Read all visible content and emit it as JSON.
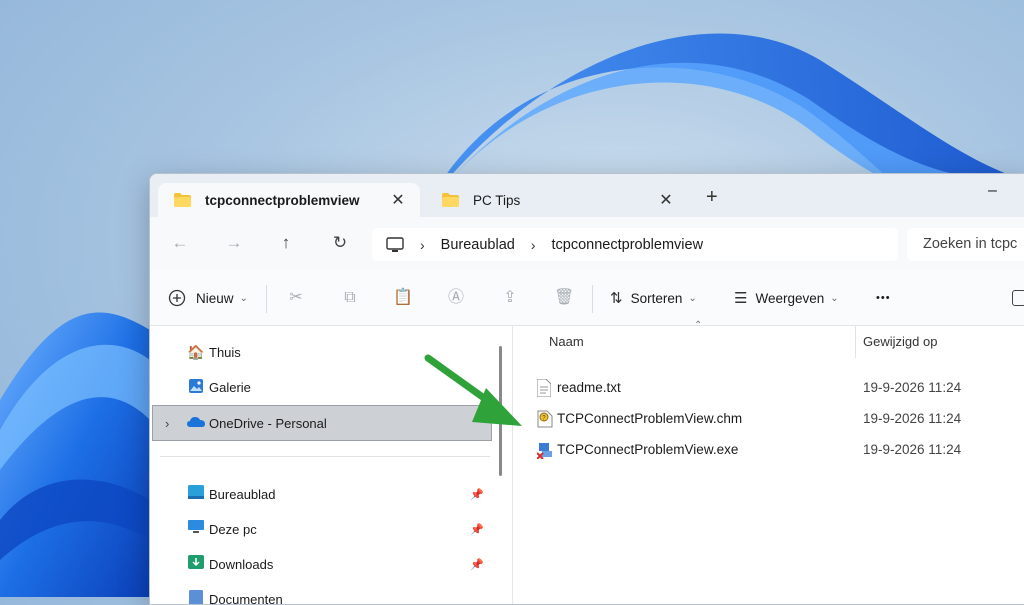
{
  "tabs": [
    {
      "label": "tcpconnectproblemview",
      "active": true
    },
    {
      "label": "PC Tips",
      "active": false
    }
  ],
  "tab_close": "✕",
  "new_tab": "+",
  "minimize": "–",
  "nav": {
    "back": "←",
    "forward": "→",
    "up": "↑",
    "refresh": "↻"
  },
  "address": {
    "segments": [
      "Bureaublad",
      "tcpconnectproblemview"
    ],
    "separator": "›"
  },
  "search": {
    "placeholder": "Zoeken in tcpc"
  },
  "toolbar": {
    "new_label": "Nieuw",
    "sort_label": "Sorteren",
    "view_label": "Weergeven",
    "more": "•••"
  },
  "navpane": {
    "items": [
      {
        "label": "Thuis",
        "icon": "home-icon"
      },
      {
        "label": "Galerie",
        "icon": "gallery-icon"
      },
      {
        "label": "OneDrive - Personal",
        "icon": "onedrive-icon",
        "selected": true,
        "expander": "›"
      },
      {
        "label": "Bureaublad",
        "icon": "desktop-icon",
        "pinned": true
      },
      {
        "label": "Deze pc",
        "icon": "pc-icon",
        "pinned": true
      },
      {
        "label": "Downloads",
        "icon": "folder-icon",
        "pinned": true
      },
      {
        "label": "Documenten",
        "icon": "documents-icon",
        "pinned": true
      }
    ]
  },
  "columns": {
    "name": "Naam",
    "modified": "Gewijzigd op"
  },
  "files": [
    {
      "name": "readme.txt",
      "modified": "19-9-2026 11:24",
      "icon": "text-file-icon"
    },
    {
      "name": "TCPConnectProblemView.chm",
      "modified": "19-9-2026 11:24",
      "icon": "chm-file-icon"
    },
    {
      "name": "TCPConnectProblemView.exe",
      "modified": "19-9-2026 11:24",
      "icon": "exe-file-icon"
    }
  ],
  "colors": {
    "accent_arrow": "#2fa33a",
    "folder_yellow": "#f3c13a",
    "wallpaper_blue": "#1f6fe0"
  }
}
